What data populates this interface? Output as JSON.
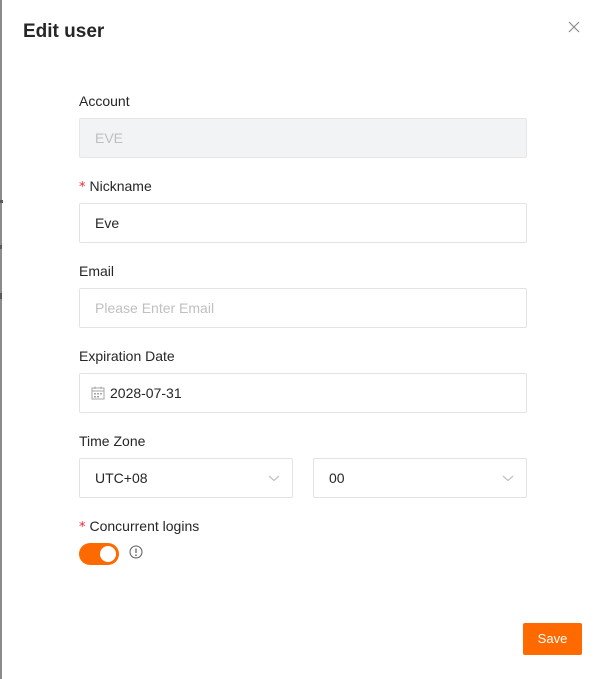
{
  "modal": {
    "title": "Edit user",
    "close_icon": "close-icon"
  },
  "form": {
    "account": {
      "label": "Account",
      "value": "EVE",
      "disabled": true
    },
    "nickname": {
      "label": "Nickname",
      "required_marker": "*",
      "value": "Eve"
    },
    "email": {
      "label": "Email",
      "value": "",
      "placeholder": "Please Enter Email"
    },
    "expiration_date": {
      "label": "Expiration Date",
      "value": "2028-07-31",
      "icon": "calendar-icon"
    },
    "time_zone": {
      "label": "Time Zone",
      "offset_hours": "UTC+08",
      "offset_minutes": "00"
    },
    "concurrent_logins": {
      "label": "Concurrent logins",
      "required_marker": "*",
      "enabled": true,
      "info_icon": "info-icon"
    }
  },
  "footer": {
    "save_label": "Save"
  },
  "colors": {
    "accent": "#ff6a00",
    "required": "#f5222d",
    "border": "#e3e3e3",
    "disabled_bg": "#f2f3f5",
    "placeholder": "#bfbfbf"
  }
}
